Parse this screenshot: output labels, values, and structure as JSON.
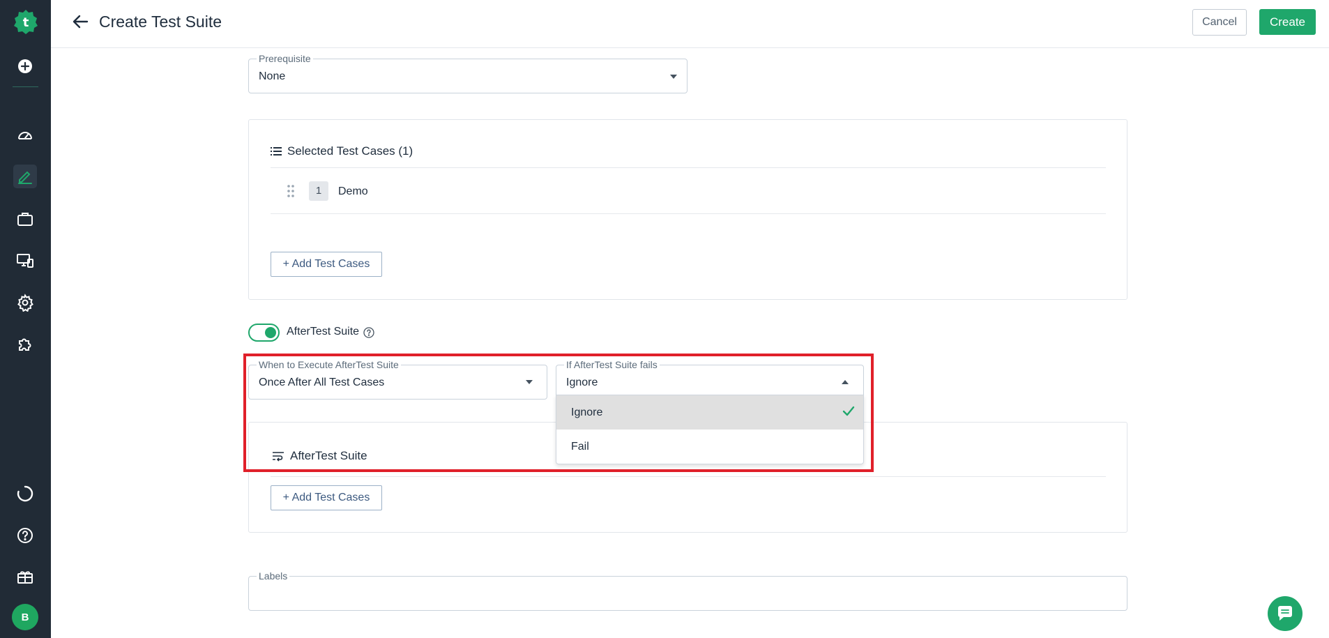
{
  "header": {
    "title": "Create Test Suite",
    "cancel_label": "Cancel",
    "create_label": "Create"
  },
  "sidebar": {
    "avatar_initial": "B",
    "icons": [
      "testsigma-logo-icon",
      "plus-circle-icon",
      "dashboard-icon",
      "edit-icon",
      "briefcase-icon",
      "devices-icon",
      "gear-icon",
      "puzzle-icon",
      "progress-icon",
      "help-icon",
      "gift-icon"
    ]
  },
  "prerequisite": {
    "label": "Prerequisite",
    "value": "None"
  },
  "selected_cases": {
    "title": "Selected Test Cases (1)",
    "items": [
      {
        "index": "1",
        "name": "Demo"
      }
    ],
    "add_label": "+ Add Test Cases"
  },
  "after_suite_toggle": {
    "label": "AfterTest Suite",
    "enabled": true
  },
  "when_execute": {
    "label": "When to Execute AfterTest Suite",
    "value": "Once After All Test Cases"
  },
  "if_fails": {
    "label": "If AfterTest Suite fails",
    "value": "Ignore",
    "options": [
      "Ignore",
      "Fail"
    ],
    "selected": "Ignore"
  },
  "after_suite_panel": {
    "title": "AfterTest Suite",
    "add_label": "+ Add Test Cases"
  },
  "labels_field": {
    "label": "Labels"
  },
  "colors": {
    "accent": "#1fa76b",
    "sidebar": "#212b36",
    "highlight": "#e0202a"
  }
}
